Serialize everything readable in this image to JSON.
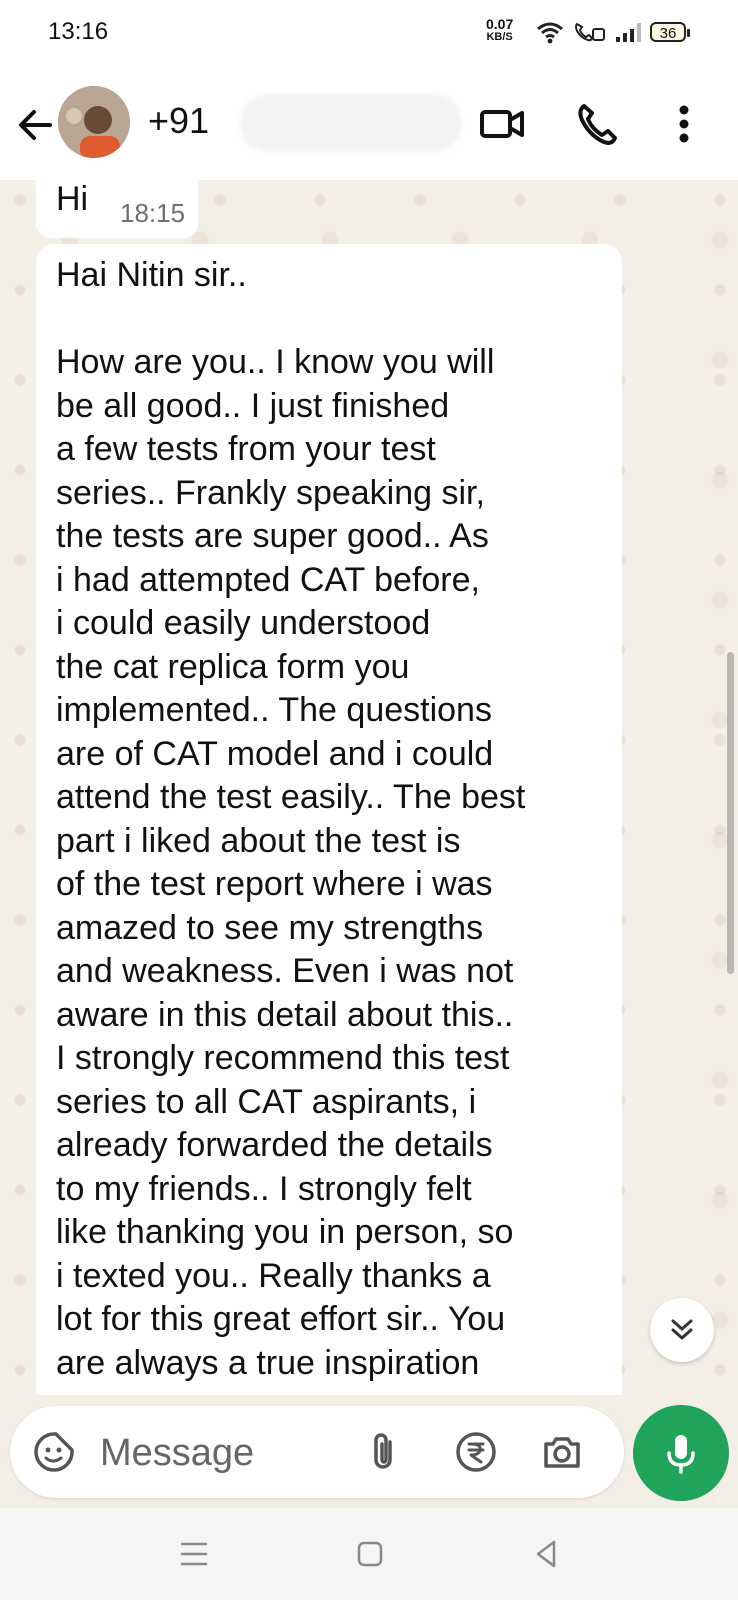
{
  "status_bar": {
    "time": "13:16",
    "net_speed_value": "0.07",
    "net_speed_unit": "KB/S",
    "battery": "36"
  },
  "header": {
    "contact_name": "+91",
    "icons": [
      "back-arrow-icon",
      "video-call-icon",
      "voice-call-icon",
      "more-options-icon"
    ]
  },
  "messages": [
    {
      "text": "Hi",
      "time": "18:15"
    },
    {
      "text": "Hai Nitin sir..\n\nHow are you.. I know you will\nbe all good.. I just finished\na few tests from your test\nseries.. Frankly speaking sir,\nthe tests are super good.. As\ni had attempted CAT before,\ni could easily understood\nthe cat replica form you\nimplemented.. The questions\nare of CAT model and i could\nattend the test easily.. The best\npart i liked about the test is\nof the test report where i was\namazed to see my strengths\nand weakness.  Even i was not\naware in this detail about this..\nI strongly recommend this test\nseries to all CAT aspirants, i\nalready forwarded the details\nto my friends.. I strongly felt\nlike thanking you in person, so\ni texted you.. Really thanks a\nlot for this great effort sir.. You\nare always a true inspiration"
    }
  ],
  "composer": {
    "placeholder": "Message",
    "icons": [
      "sticker-icon",
      "attach-icon",
      "rupee-payment-icon",
      "camera-icon",
      "mic-icon"
    ]
  },
  "colors": {
    "accent_green": "#20a35a",
    "chat_background": "#f4efe6",
    "bubble": "#ffffff"
  }
}
